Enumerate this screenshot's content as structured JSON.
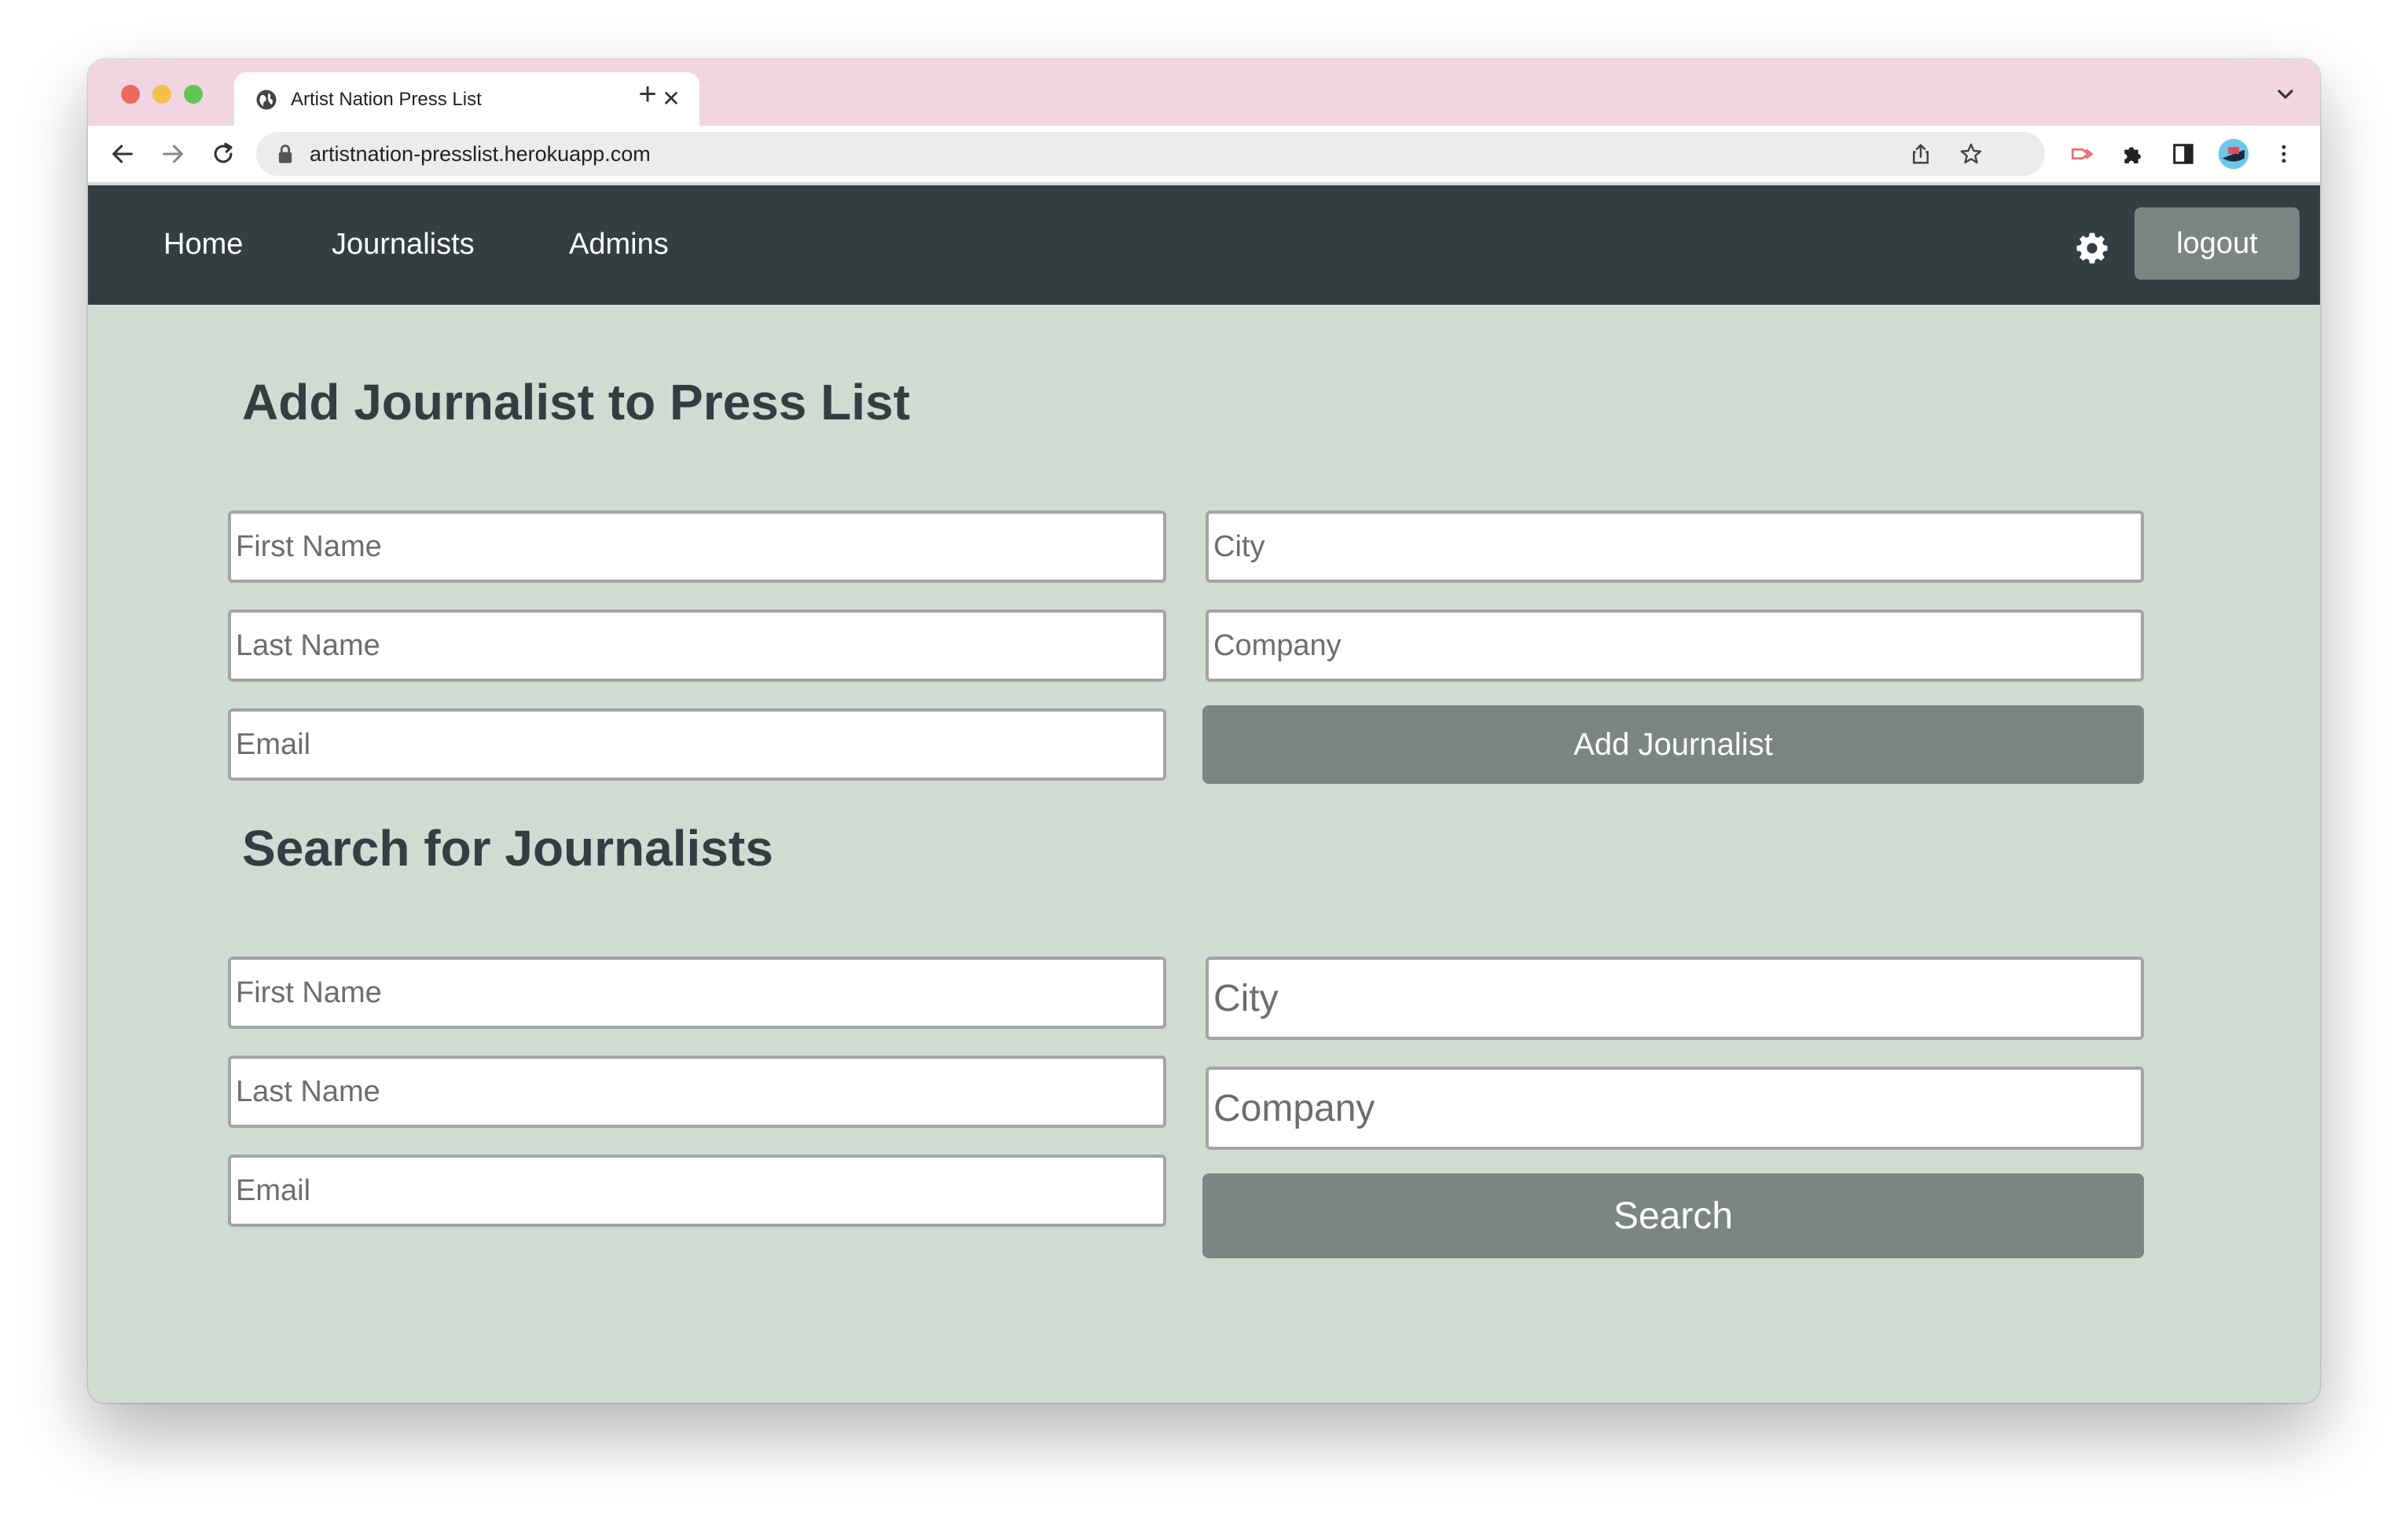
{
  "browser": {
    "tab_title": "Artist Nation Press List",
    "url": "artistnation-presslist.herokuapp.com",
    "traffic_colors": {
      "close": "#ed6a5e",
      "minimize": "#f5bf4f",
      "zoom": "#61c554"
    },
    "icons": [
      "globe-icon",
      "close-icon",
      "plus-icon",
      "chevron-down-icon",
      "back-icon",
      "forward-icon",
      "reload-icon",
      "lock-icon",
      "share-icon",
      "star-icon",
      "extension-arrow-icon",
      "puzzle-icon",
      "sidebar-icon",
      "profile-avatar",
      "more-vertical-icon"
    ]
  },
  "nav": {
    "items": [
      {
        "label": "Home"
      },
      {
        "label": "Journalists"
      },
      {
        "label": "Admins"
      }
    ],
    "settings_icon": "gear-icon",
    "logout_label": "logout",
    "background": "#323e40"
  },
  "add_section": {
    "title": "Add Journalist to Press List",
    "fields": {
      "first_name": {
        "placeholder": "First Name",
        "value": ""
      },
      "last_name": {
        "placeholder": "Last Name",
        "value": ""
      },
      "email": {
        "placeholder": "Email",
        "value": ""
      },
      "city": {
        "placeholder": "City",
        "value": ""
      },
      "company": {
        "placeholder": "Company",
        "value": ""
      }
    },
    "button_label": "Add Journalist"
  },
  "search_section": {
    "title": "Search for Journalists",
    "fields": {
      "first_name": {
        "placeholder": "First Name",
        "value": ""
      },
      "last_name": {
        "placeholder": "Last Name",
        "value": ""
      },
      "email": {
        "placeholder": "Email",
        "value": ""
      },
      "city": {
        "placeholder": "City",
        "value": ""
      },
      "company": {
        "placeholder": "Company",
        "value": ""
      }
    },
    "button_label": "Search"
  },
  "colors": {
    "page_background": "#d0dbd3",
    "button": "#7b8584",
    "heading": "#323e40"
  }
}
